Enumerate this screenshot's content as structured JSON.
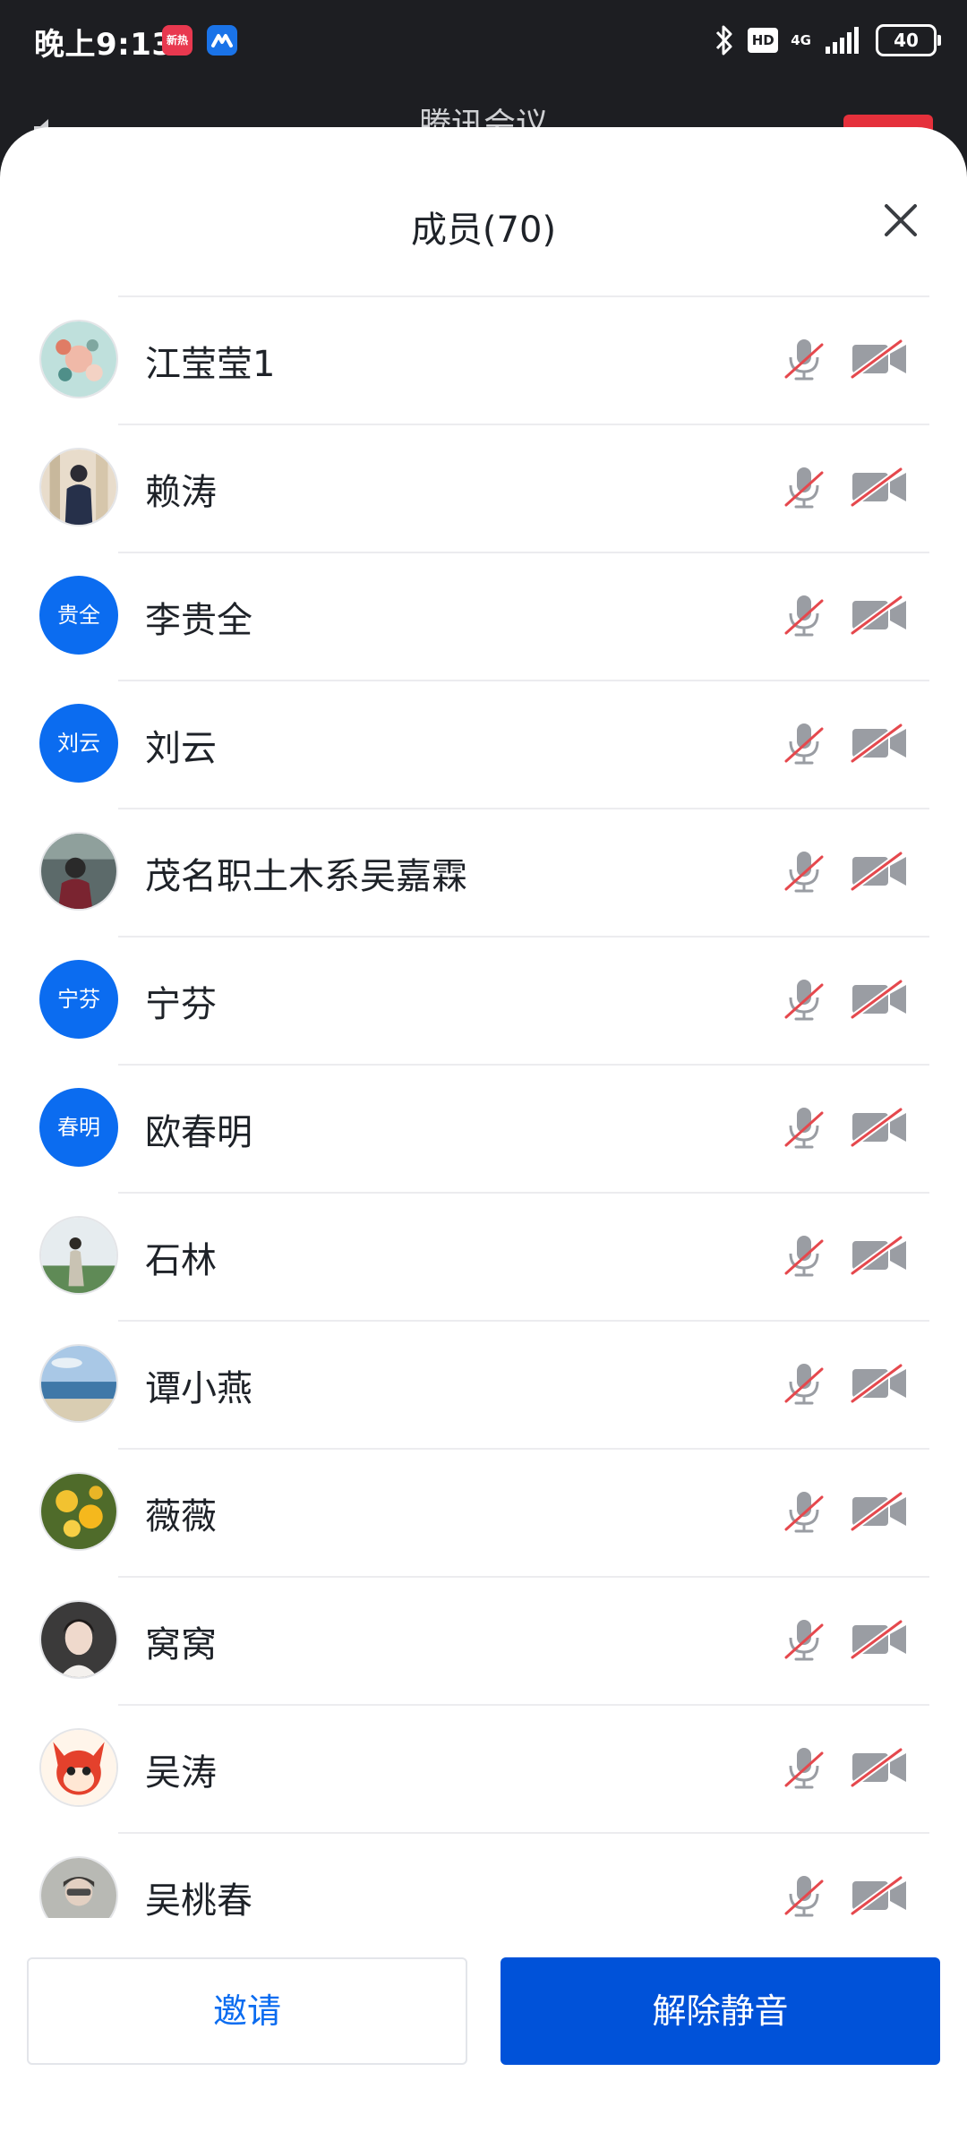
{
  "status_bar": {
    "time": "晚上9:13",
    "app_badge_1": "新热",
    "hd": "HD",
    "network": "4G",
    "battery": "40"
  },
  "meeting_header": {
    "title": "腾讯会议"
  },
  "sheet": {
    "title": "成员(70)"
  },
  "members": [
    {
      "name": "江莹莹1",
      "avatar_type": "image",
      "avatar_desc": "floral-pattern",
      "mic": "muted",
      "camera": "off"
    },
    {
      "name": "赖涛",
      "avatar_type": "image",
      "avatar_desc": "person-in-suit",
      "mic": "muted",
      "camera": "off"
    },
    {
      "name": "李贵全",
      "avatar_type": "text",
      "avatar_text": "贵全",
      "mic": "muted",
      "camera": "off"
    },
    {
      "name": "刘云",
      "avatar_type": "text",
      "avatar_text": "刘云",
      "mic": "muted",
      "camera": "off"
    },
    {
      "name": "茂名职土木系吴嘉霖",
      "avatar_type": "image",
      "avatar_desc": "person-selfie",
      "mic": "muted",
      "camera": "off"
    },
    {
      "name": "宁芬",
      "avatar_type": "text",
      "avatar_text": "宁芬",
      "mic": "muted",
      "camera": "off"
    },
    {
      "name": "欧春明",
      "avatar_type": "text",
      "avatar_text": "春明",
      "mic": "muted",
      "camera": "off"
    },
    {
      "name": "石林",
      "avatar_type": "image",
      "avatar_desc": "person-on-field",
      "mic": "muted",
      "camera": "off"
    },
    {
      "name": "谭小燕",
      "avatar_type": "image",
      "avatar_desc": "beach-scene",
      "mic": "muted",
      "camera": "off"
    },
    {
      "name": "薇薇",
      "avatar_type": "image",
      "avatar_desc": "yellow-flowers",
      "mic": "muted",
      "camera": "off"
    },
    {
      "name": "窝窝",
      "avatar_type": "image",
      "avatar_desc": "woman-portrait",
      "mic": "muted",
      "camera": "off"
    },
    {
      "name": "吴涛",
      "avatar_type": "image",
      "avatar_desc": "cartoon-fox",
      "mic": "muted",
      "camera": "off"
    },
    {
      "name": "吴桃春",
      "avatar_type": "image",
      "avatar_desc": "person-portrait",
      "mic": "muted",
      "camera": "off"
    }
  ],
  "footer": {
    "invite_label": "邀请",
    "unmute_all_label": "解除静音"
  },
  "colors": {
    "primary": "#0052d9",
    "text_avatar_bg": "#0b6cf0",
    "muted_slash": "#e5484d",
    "icon_gray": "#9a9da3"
  }
}
